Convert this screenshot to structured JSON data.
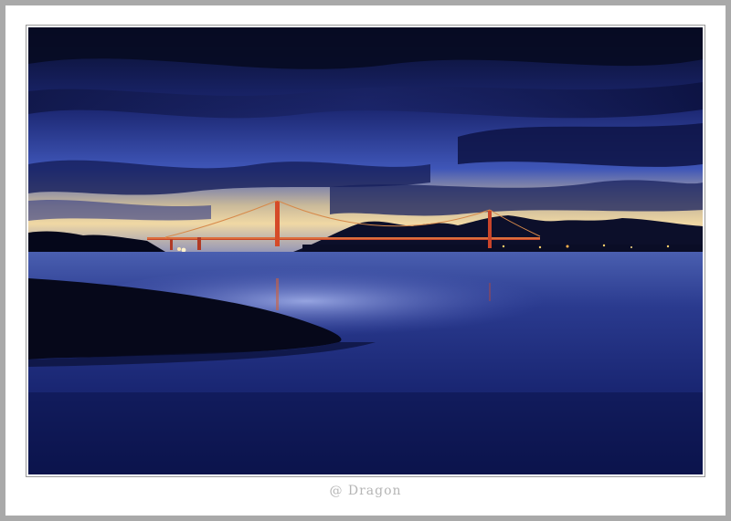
{
  "watermark": {
    "text": "@ Dragon"
  },
  "colors": {
    "sky_top": "#0b1235",
    "sky_mid": "#2a3a8c",
    "horizon_glow": "#f2d9a0",
    "water": "#1c2a78",
    "bridge": "#e0502a",
    "beach": "#07091a"
  }
}
